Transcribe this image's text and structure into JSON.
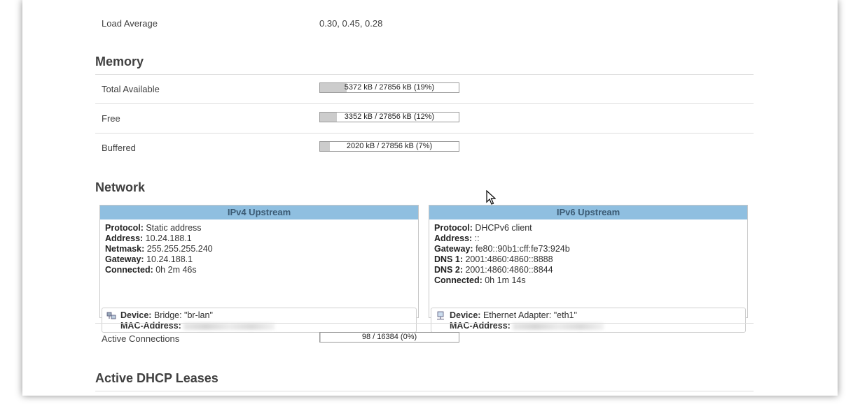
{
  "system": {
    "load_average_label": "Load Average",
    "load_average_value": "0.30, 0.45, 0.28"
  },
  "memory": {
    "title": "Memory",
    "rows": [
      {
        "label": "Total Available",
        "text": "5372 kB / 27856 kB (19%)",
        "fraction": 0.19
      },
      {
        "label": "Free",
        "text": "3352 kB / 27856 kB (12%)",
        "fraction": 0.12
      },
      {
        "label": "Buffered",
        "text": "2020 kB / 27856 kB (7%)",
        "fraction": 0.07
      }
    ]
  },
  "network": {
    "title": "Network",
    "ipv4": {
      "header": "IPv4 Upstream",
      "protocol_label": "Protocol:",
      "protocol": "Static address",
      "address_label": "Address:",
      "address": "10.24.188.1",
      "netmask_label": "Netmask:",
      "netmask": "255.255.255.240",
      "gateway_label": "Gateway:",
      "gateway": "10.24.188.1",
      "connected_label": "Connected:",
      "connected": "0h 2m 46s",
      "device_label": "Device:",
      "device": "Bridge: \"br-lan\"",
      "mac_label": "MAC-Address:",
      "device_icon": "bridge-icon"
    },
    "ipv6": {
      "header": "IPv6 Upstream",
      "protocol_label": "Protocol:",
      "protocol": "DHCPv6 client",
      "address_label": "Address:",
      "address": "::",
      "gateway_label": "Gateway:",
      "gateway": "fe80::90b1:cff:fe73:924b",
      "dns1_label": "DNS 1:",
      "dns1": "2001:4860:4860::8888",
      "dns2_label": "DNS 2:",
      "dns2": "2001:4860:4860::8844",
      "connected_label": "Connected:",
      "connected": "0h 1m 14s",
      "device_label": "Device:",
      "device": "Ethernet Adapter: \"eth1\"",
      "mac_label": "MAC-Address:",
      "device_icon": "ethernet-icon"
    },
    "active_connections": {
      "label": "Active Connections",
      "text": "98 / 16384 (0%)",
      "fraction": 0.006
    }
  },
  "dhcp": {
    "title": "Active DHCP Leases"
  },
  "colors": {
    "header_blue": "#8fbfe0",
    "bar_fill": "#cccccc"
  }
}
